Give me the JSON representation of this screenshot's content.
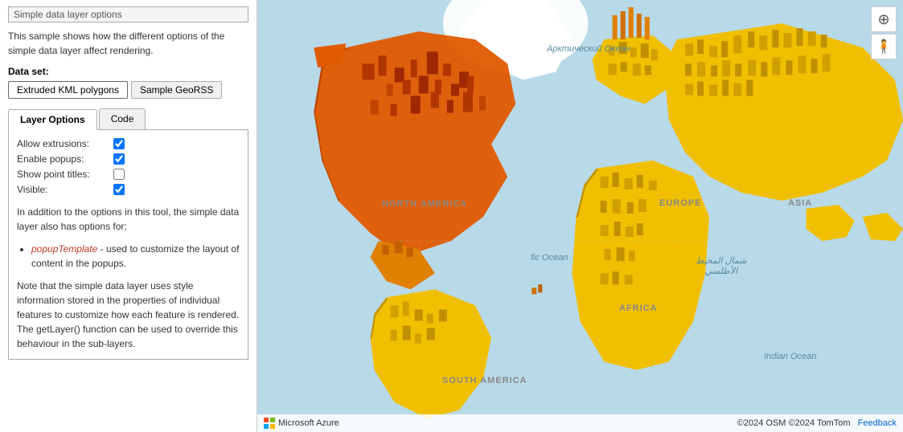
{
  "panel": {
    "section_title": "Simple data layer options",
    "description": "This sample shows how the different options of the simple data layer affect rendering.",
    "dataset_label": "Data set:",
    "datasets": [
      {
        "label": "Extruded KML polygons",
        "active": true
      },
      {
        "label": "Sample GeoRSS",
        "active": false
      }
    ],
    "tabs": [
      {
        "label": "Layer Options",
        "active": true
      },
      {
        "label": "Code",
        "active": false
      }
    ],
    "options": [
      {
        "label": "Allow extrusions:",
        "checked": true,
        "name": "allow-extrusions"
      },
      {
        "label": "Enable popups:",
        "checked": true,
        "name": "enable-popups"
      },
      {
        "label": "Show point titles:",
        "checked": false,
        "name": "show-point-titles"
      },
      {
        "label": "Visible:",
        "checked": true,
        "name": "visible"
      }
    ],
    "info_text": "In addition to the options in this tool, the simple data layer also has options for;",
    "bullets": [
      "popupTemplate - used to customize the layout of content in the popups."
    ],
    "note_text": "Note that the simple data layer uses style information stored in the properties of individual features to customize how each feature is rendered. The getLayer() function can be used to override this behaviour in the sub-layers."
  },
  "map": {
    "copyright": "©2024 OSM ©2024 TomTom",
    "feedback_label": "Feedback",
    "azure_label": "Microsoft Azure",
    "controls": {
      "zoom_in": "⊕",
      "person": "🧍"
    },
    "labels": {
      "north_america": "NORTH AMERICA",
      "south_america": "SOUTH AMERICA",
      "europe": "EUROPE",
      "africa": "AFRICA",
      "asia": "ASIA",
      "arctic_ocean": "Арктический Океан",
      "atlantic_ocean_label": "fic Ocean",
      "north_atlantic": "شمال المحيط\nالأطلسي",
      "indian_ocean": "Indian Ocean"
    }
  }
}
